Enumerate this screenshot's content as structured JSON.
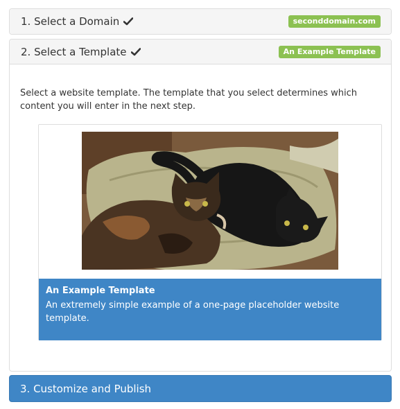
{
  "steps": [
    {
      "title": "1. Select a Domain",
      "completed": true,
      "badge": "seconddomain.com"
    },
    {
      "title": "2. Select a Template",
      "completed": true,
      "badge": "An Example Template"
    },
    {
      "title": "3. Customize and Publish"
    }
  ],
  "template_step": {
    "intro": "Select a website template. The template that you select determines which content you will enter in the next step.",
    "template_card": {
      "image": "cats-photo",
      "name": "An Example Template",
      "description": "An extremely simple example of a one-page placeholder website template."
    }
  },
  "colors": {
    "badge": "#8cc152",
    "accent": "#3f86c6",
    "panel_header": "#f5f5f5"
  },
  "icons": {
    "check": "check-icon"
  }
}
